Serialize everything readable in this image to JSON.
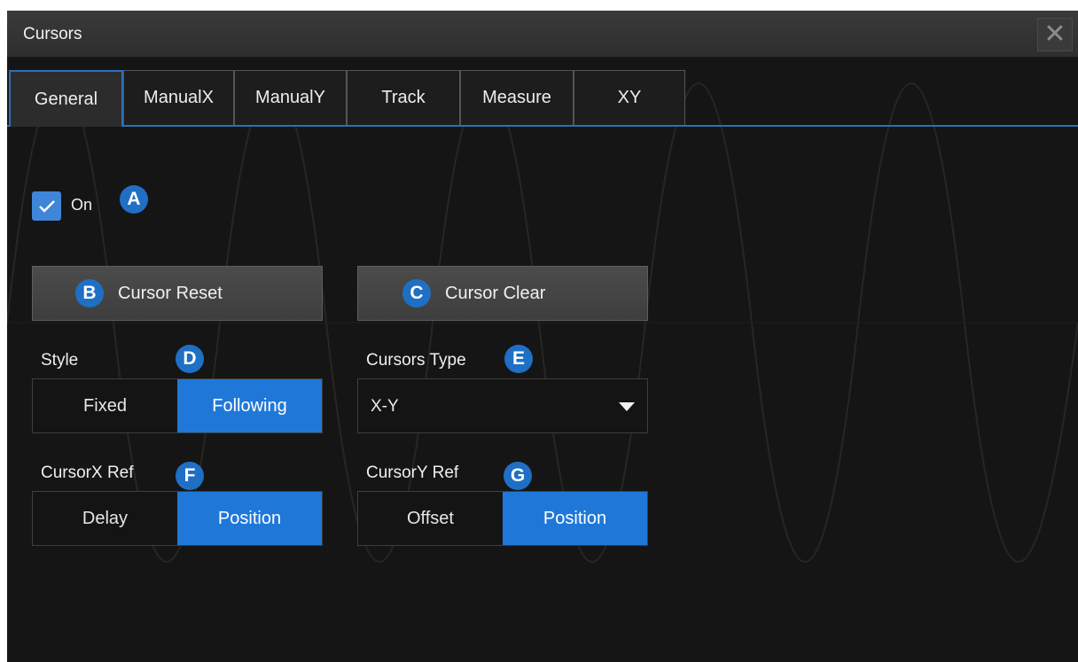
{
  "window": {
    "title": "Cursors",
    "close_icon": "close-icon"
  },
  "tabs": [
    {
      "label": "General",
      "active": true
    },
    {
      "label": "ManualX",
      "active": false
    },
    {
      "label": "ManualY",
      "active": false
    },
    {
      "label": "Track",
      "active": false
    },
    {
      "label": "Measure",
      "active": false
    },
    {
      "label": "XY",
      "active": false
    }
  ],
  "general": {
    "on_checkbox": {
      "label": "On",
      "checked": true
    },
    "cursor_reset_label": "Cursor Reset",
    "cursor_clear_label": "Cursor Clear",
    "style": {
      "label": "Style",
      "options": [
        "Fixed",
        "Following"
      ],
      "selected": "Following"
    },
    "cursors_type": {
      "label": "Cursors Type",
      "value": "X-Y"
    },
    "cursorx_ref": {
      "label": "CursorX Ref",
      "options": [
        "Delay",
        "Position"
      ],
      "selected": "Position"
    },
    "cursory_ref": {
      "label": "CursorY Ref",
      "options": [
        "Offset",
        "Position"
      ],
      "selected": "Position"
    }
  },
  "markers": {
    "a": "A",
    "b": "B",
    "c": "C",
    "d": "D",
    "e": "E",
    "f": "F",
    "g": "G"
  },
  "colors": {
    "accent": "#1f78d8",
    "marker": "#1f6fc5",
    "background": "#151515"
  }
}
